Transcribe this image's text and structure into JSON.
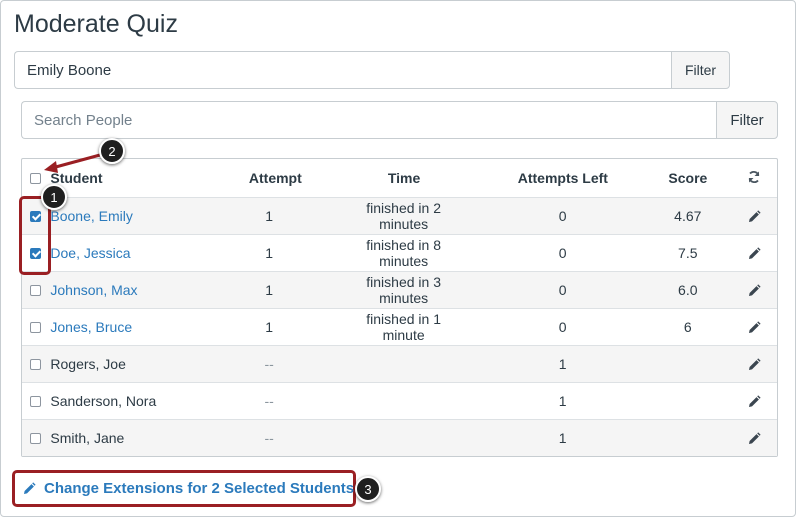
{
  "page": {
    "title": "Moderate Quiz"
  },
  "filter_search": {
    "value": "Emily Boone",
    "button": "Filter"
  },
  "people_search": {
    "placeholder": "Search People",
    "button": "Filter"
  },
  "table": {
    "headers": {
      "student": "Student",
      "attempt": "Attempt",
      "time": "Time",
      "attempts_left": "Attempts Left",
      "score": "Score"
    },
    "rows": [
      {
        "student": "Boone, Emily",
        "attempt": "1",
        "time": "finished in 2 minutes",
        "attempts_left": "0",
        "score": "4.67",
        "checked": true,
        "linked": true
      },
      {
        "student": "Doe, Jessica",
        "attempt": "1",
        "time": "finished in 8 minutes",
        "attempts_left": "0",
        "score": "7.5",
        "checked": true,
        "linked": true
      },
      {
        "student": "Johnson, Max",
        "attempt": "1",
        "time": "finished in 3 minutes",
        "attempts_left": "0",
        "score": "6.0",
        "checked": false,
        "linked": true
      },
      {
        "student": "Jones, Bruce",
        "attempt": "1",
        "time": "finished in 1 minute",
        "attempts_left": "0",
        "score": "6",
        "checked": false,
        "linked": true
      },
      {
        "student": "Rogers, Joe",
        "attempt": "--",
        "time": "",
        "attempts_left": "1",
        "score": "",
        "checked": false,
        "linked": false
      },
      {
        "student": "Sanderson, Nora",
        "attempt": "--",
        "time": "",
        "attempts_left": "1",
        "score": "",
        "checked": false,
        "linked": false
      },
      {
        "student": "Smith, Jane",
        "attempt": "--",
        "time": "",
        "attempts_left": "1",
        "score": "",
        "checked": false,
        "linked": false
      }
    ]
  },
  "change_extensions": {
    "label": "Change Extensions for 2 Selected Students"
  },
  "annotations": {
    "badge1": "1",
    "badge2": "2",
    "badge3": "3",
    "color": "#9a1f23"
  },
  "colors": {
    "link": "#2b7abc",
    "text": "#2d3b45"
  },
  "icons": {
    "refresh": "refresh-icon",
    "edit": "pencil-icon"
  }
}
